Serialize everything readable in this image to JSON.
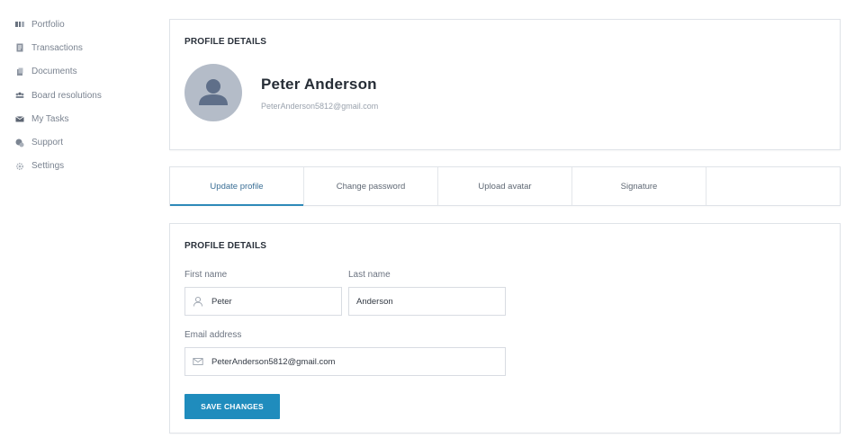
{
  "sidebar": {
    "items": [
      {
        "label": "Portfolio",
        "icon": "portfolio-icon"
      },
      {
        "label": "Transactions",
        "icon": "transactions-icon"
      },
      {
        "label": "Documents",
        "icon": "documents-icon"
      },
      {
        "label": "Board resolutions",
        "icon": "board-resolutions-icon"
      },
      {
        "label": "My Tasks",
        "icon": "tasks-icon"
      },
      {
        "label": "Support",
        "icon": "support-icon"
      },
      {
        "label": "Settings",
        "icon": "settings-icon"
      }
    ]
  },
  "profile_card": {
    "title": "PROFILE DETAILS",
    "name": "Peter Anderson",
    "email": "PeterAnderson5812@gmail.com"
  },
  "tabs": [
    {
      "label": "Update profile",
      "active": true
    },
    {
      "label": "Change password",
      "active": false
    },
    {
      "label": "Upload avatar",
      "active": false
    },
    {
      "label": "Signature",
      "active": false
    }
  ],
  "form": {
    "title": "PROFILE DETAILS",
    "first_name_label": "First name",
    "first_name_value": "Peter",
    "last_name_label": "Last name",
    "last_name_value": "Anderson",
    "email_label": "Email address",
    "email_value": "PeterAnderson5812@gmail.com",
    "save_label": "SAVE CHANGES"
  },
  "colors": {
    "accent": "#1f8cbd",
    "tab_active_text": "#3b6f96",
    "avatar_bg": "#b4bcc8",
    "avatar_figure": "#5f6f89"
  }
}
